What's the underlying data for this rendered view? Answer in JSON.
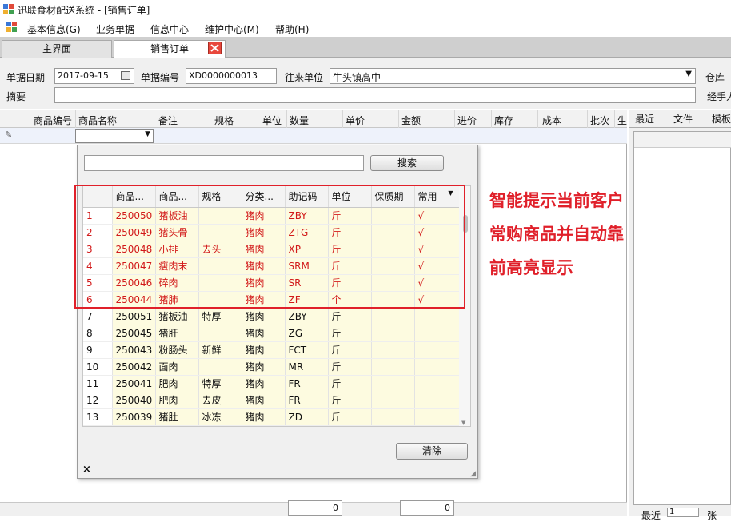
{
  "window": {
    "title": "迅联食材配送系统 - [销售订单]"
  },
  "menu": [
    {
      "label": "基本信息(G)"
    },
    {
      "label": "业务单据"
    },
    {
      "label": "信息中心"
    },
    {
      "label": "维护中心(M)"
    },
    {
      "label": "帮助(H)"
    }
  ],
  "tabs": [
    {
      "label": "主界面"
    },
    {
      "label": "销售订单"
    }
  ],
  "form": {
    "date_label": "单据日期",
    "date_value": "2017-09-15",
    "number_label": "单据编号",
    "number_value": "XD0000000013",
    "partner_label": "往来单位",
    "partner_value": "牛头镇高中",
    "warehouse_label": "仓库",
    "summary_label": "摘要",
    "handler_label": "经手人"
  },
  "grid": {
    "columns": [
      "商品编号",
      "商品名称",
      "备注",
      "规格",
      "单位",
      "数量",
      "单价",
      "金额",
      "进价",
      "库存",
      "成本",
      "批次",
      "生"
    ]
  },
  "right_panel": {
    "tabs": [
      "最近",
      "文件",
      "模板"
    ],
    "bottom_label": "最近",
    "bottom_value": "1",
    "bottom_extra": "张"
  },
  "popup": {
    "search_button": "搜索",
    "clear_button": "清除",
    "close_glyph": "×",
    "columns": [
      "商品...",
      "商品...",
      "规格",
      "分类...",
      "助记码",
      "单位",
      "保质期",
      "常用"
    ],
    "rows": [
      {
        "n": "1",
        "code": "250050",
        "name": "猪板油",
        "spec": "",
        "cat": "猪肉",
        "mnem": "ZBY",
        "unit": "斤",
        "shelf": "",
        "freq": "√",
        "hl": true
      },
      {
        "n": "2",
        "code": "250049",
        "name": "猪头骨",
        "spec": "",
        "cat": "猪肉",
        "mnem": "ZTG",
        "unit": "斤",
        "shelf": "",
        "freq": "√",
        "hl": true
      },
      {
        "n": "3",
        "code": "250048",
        "name": "小排",
        "spec": "去头",
        "cat": "猪肉",
        "mnem": "XP",
        "unit": "斤",
        "shelf": "",
        "freq": "√",
        "hl": true
      },
      {
        "n": "4",
        "code": "250047",
        "name": "瘦肉末",
        "spec": "",
        "cat": "猪肉",
        "mnem": "SRM",
        "unit": "斤",
        "shelf": "",
        "freq": "√",
        "hl": true
      },
      {
        "n": "5",
        "code": "250046",
        "name": "碎肉",
        "spec": "",
        "cat": "猪肉",
        "mnem": "SR",
        "unit": "斤",
        "shelf": "",
        "freq": "√",
        "hl": true
      },
      {
        "n": "6",
        "code": "250044",
        "name": "猪肺",
        "spec": "",
        "cat": "猪肉",
        "mnem": "ZF",
        "unit": "个",
        "shelf": "",
        "freq": "√",
        "hl": true
      },
      {
        "n": "7",
        "code": "250051",
        "name": "猪板油",
        "spec": "特厚",
        "cat": "猪肉",
        "mnem": "ZBY",
        "unit": "斤",
        "shelf": "",
        "freq": "",
        "hl": false
      },
      {
        "n": "8",
        "code": "250045",
        "name": "猪肝",
        "spec": "",
        "cat": "猪肉",
        "mnem": "ZG",
        "unit": "斤",
        "shelf": "",
        "freq": "",
        "hl": false
      },
      {
        "n": "9",
        "code": "250043",
        "name": "粉肠头",
        "spec": "新鲜",
        "cat": "猪肉",
        "mnem": "FCT",
        "unit": "斤",
        "shelf": "",
        "freq": "",
        "hl": false
      },
      {
        "n": "10",
        "code": "250042",
        "name": "面肉",
        "spec": "",
        "cat": "猪肉",
        "mnem": "MR",
        "unit": "斤",
        "shelf": "",
        "freq": "",
        "hl": false
      },
      {
        "n": "11",
        "code": "250041",
        "name": "肥肉",
        "spec": "特厚",
        "cat": "猪肉",
        "mnem": "FR",
        "unit": "斤",
        "shelf": "",
        "freq": "",
        "hl": false
      },
      {
        "n": "12",
        "code": "250040",
        "name": "肥肉",
        "spec": "去皮",
        "cat": "猪肉",
        "mnem": "FR",
        "unit": "斤",
        "shelf": "",
        "freq": "",
        "hl": false
      },
      {
        "n": "13",
        "code": "250039",
        "name": "猪肚",
        "spec": "冰冻",
        "cat": "猪肉",
        "mnem": "ZD",
        "unit": "斤",
        "shelf": "",
        "freq": "",
        "hl": false
      }
    ]
  },
  "annotation": {
    "lines": [
      "智能提示当前客户",
      "常购商品并自动靠",
      "前高亮显示"
    ]
  },
  "totals": {
    "qty": "0",
    "amount": "0"
  },
  "colors": {
    "highlight_text": "#d21a1a",
    "annotation": "#e0202a",
    "row_bg": "#fdfbe0"
  }
}
